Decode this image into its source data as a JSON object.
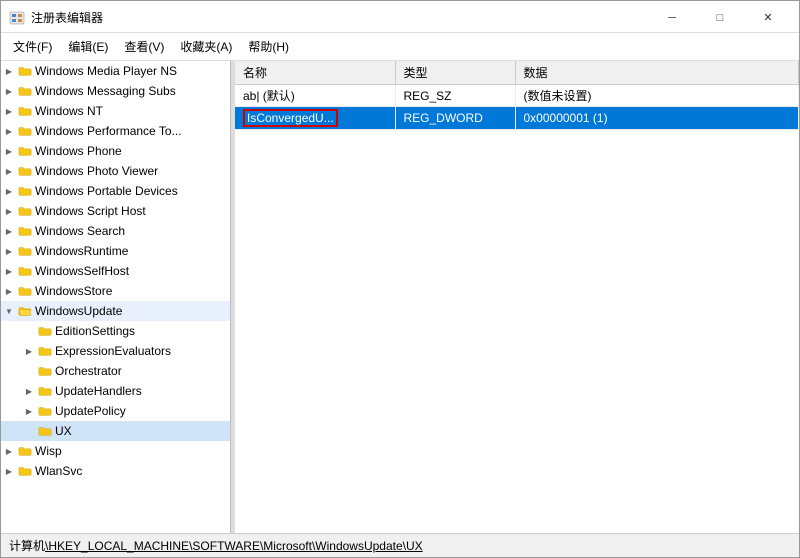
{
  "window": {
    "title": "注册表编辑器",
    "controls": {
      "minimize": "─",
      "maximize": "□",
      "close": "✕"
    }
  },
  "menu": {
    "items": [
      "文件(F)",
      "编辑(E)",
      "查看(V)",
      "收藏夹(A)",
      "帮助(H)"
    ]
  },
  "tree": {
    "items": [
      {
        "id": "wmp",
        "label": "Windows Media Player NS",
        "indent": 0,
        "has_children": true,
        "expanded": false
      },
      {
        "id": "wms",
        "label": "Windows Messaging Subs",
        "indent": 0,
        "has_children": true,
        "expanded": false
      },
      {
        "id": "wnt",
        "label": "Windows NT",
        "indent": 0,
        "has_children": true,
        "expanded": false
      },
      {
        "id": "wpt",
        "label": "Windows Performance To...",
        "indent": 0,
        "has_children": true,
        "expanded": false
      },
      {
        "id": "wph",
        "label": "Windows Phone",
        "indent": 0,
        "has_children": true,
        "expanded": false
      },
      {
        "id": "wpv",
        "label": "Windows Photo Viewer",
        "indent": 0,
        "has_children": true,
        "expanded": false
      },
      {
        "id": "wpd",
        "label": "Windows Portable Devices",
        "indent": 0,
        "has_children": true,
        "expanded": false
      },
      {
        "id": "wsh",
        "label": "Windows Script Host",
        "indent": 0,
        "has_children": true,
        "expanded": false
      },
      {
        "id": "wse",
        "label": "Windows Search",
        "indent": 0,
        "has_children": true,
        "expanded": false
      },
      {
        "id": "wrt",
        "label": "WindowsRuntime",
        "indent": 0,
        "has_children": true,
        "expanded": false
      },
      {
        "id": "wself",
        "label": "WindowsSelfHost",
        "indent": 0,
        "has_children": true,
        "expanded": false
      },
      {
        "id": "wstore",
        "label": "WindowsStore",
        "indent": 0,
        "has_children": true,
        "expanded": false
      },
      {
        "id": "wu",
        "label": "WindowsUpdate",
        "indent": 0,
        "has_children": true,
        "expanded": true
      },
      {
        "id": "es",
        "label": "EditionSettings",
        "indent": 1,
        "has_children": false,
        "expanded": false
      },
      {
        "id": "ee",
        "label": "ExpressionEvaluators",
        "indent": 1,
        "has_children": true,
        "expanded": false
      },
      {
        "id": "or",
        "label": "Orchestrator",
        "indent": 1,
        "has_children": false,
        "expanded": false
      },
      {
        "id": "uh",
        "label": "UpdateHandlers",
        "indent": 1,
        "has_children": true,
        "expanded": false
      },
      {
        "id": "up",
        "label": "UpdatePolicy",
        "indent": 1,
        "has_children": true,
        "expanded": false
      },
      {
        "id": "ux",
        "label": "UX",
        "indent": 1,
        "has_children": false,
        "expanded": false,
        "selected": true
      },
      {
        "id": "wisp",
        "label": "Wisp",
        "indent": 0,
        "has_children": true,
        "expanded": false
      },
      {
        "id": "wlan",
        "label": "WlanSvc",
        "indent": 0,
        "has_children": true,
        "expanded": false
      }
    ]
  },
  "registry_table": {
    "columns": [
      "名称",
      "类型",
      "数据"
    ],
    "rows": [
      {
        "id": "default",
        "name": "ab| (默认)",
        "type": "REG_SZ",
        "data": "(数值未设置)",
        "selected": false,
        "highlighted": false
      },
      {
        "id": "isconverged",
        "name": "IsConvergedU...",
        "type": "REG_DWORD",
        "data": "0x00000001 (1)",
        "selected": true,
        "highlighted": true
      }
    ]
  },
  "status_bar": {
    "text": "计算机\\HKEY_LOCAL_MACHINE\\SOFTWARE\\Microsoft\\WindowsUpdate\\UX",
    "underline_start": 3,
    "path": "\\HKEY_LOCAL_MACHINE\\SOFTWARE\\Microsoft\\WindowsUpdate\\UX"
  },
  "colors": {
    "selected_bg": "#0078d7",
    "selected_text": "#ffffff",
    "highlight_border": "#cc0000",
    "folder_color": "#f5c518",
    "open_folder_color": "#f5c518"
  }
}
